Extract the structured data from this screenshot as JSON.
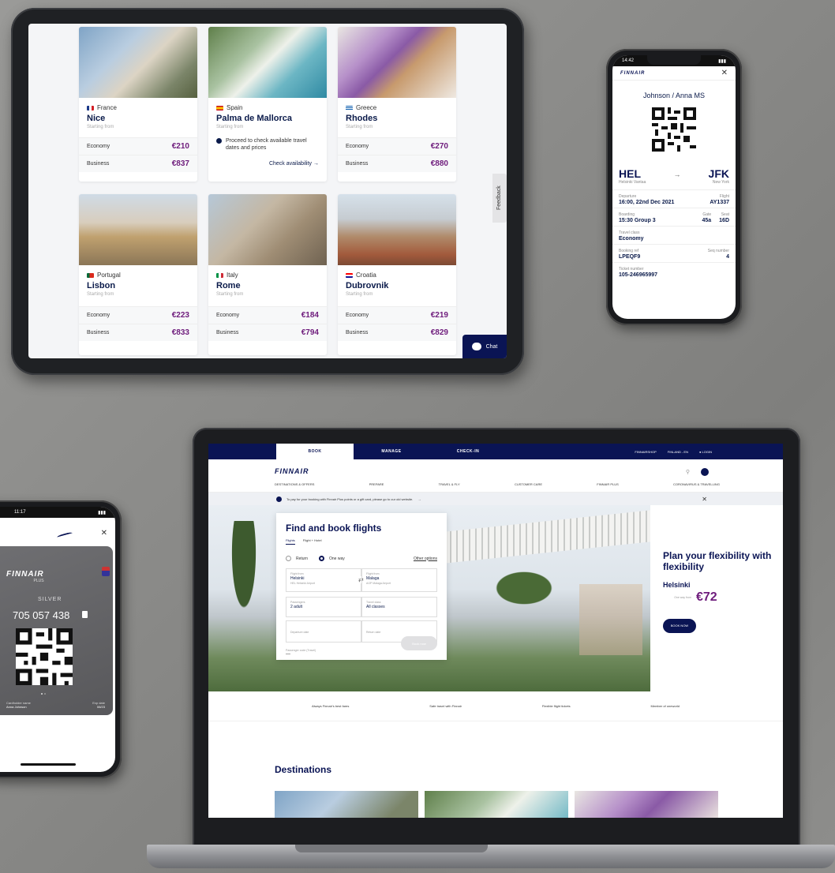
{
  "tablet": {
    "feedback_label": "Feedback",
    "chat_label": "Chat",
    "cards": [
      {
        "country": "France",
        "city": "Nice",
        "from": "Starting from",
        "economy_label": "Economy",
        "economy_price": "€210",
        "business_label": "Business",
        "business_price": "€837"
      },
      {
        "country": "Spain",
        "city": "Palma de Mallorca",
        "from": "Starting from",
        "info": "Proceed to check available travel dates and prices",
        "check_label": "Check availability →"
      },
      {
        "country": "Greece",
        "city": "Rhodes",
        "from": "Starting from",
        "economy_label": "Economy",
        "economy_price": "€270",
        "business_label": "Business",
        "business_price": "€880"
      },
      {
        "country": "Portugal",
        "city": "Lisbon",
        "from": "Starting from",
        "economy_label": "Economy",
        "economy_price": "€223",
        "business_label": "Business",
        "business_price": "€833"
      },
      {
        "country": "Italy",
        "city": "Rome",
        "from": "Starting from",
        "economy_label": "Economy",
        "economy_price": "€184",
        "business_label": "Business",
        "business_price": "€794"
      },
      {
        "country": "Croatia",
        "city": "Dubrovnik",
        "from": "Starting from",
        "economy_label": "Economy",
        "economy_price": "€219",
        "business_label": "Business",
        "business_price": "€829"
      }
    ]
  },
  "boarding_pass": {
    "time": "14:42",
    "logo": "FINNAIR",
    "close": "✕",
    "passenger": "Johnson / Anna MS",
    "from_code": "HEL",
    "from_city": "Helsinki Vantaa",
    "arrow": "→",
    "to_code": "JFK",
    "to_city": "New York",
    "departure_label": "Departure",
    "departure_value": "16:00, 22nd Dec 2021",
    "flight_label": "Flight",
    "flight_value": "AY1337",
    "boarding_label": "Boarding",
    "boarding_value": "15:30 Group 3",
    "gate_label": "Gate",
    "gate_value": "45a",
    "seat_label": "Seat",
    "seat_value": "16D",
    "class_label": "Travel class",
    "class_value": "Economy",
    "ref_label": "Booking ref",
    "ref_value": "LPEQF9",
    "seq_label": "Seq number",
    "seq_value": "4",
    "ticket_label": "Ticket number",
    "ticket_value": "105-246965997"
  },
  "plus_card": {
    "time": "11:17",
    "close": "✕",
    "logo": "FINNAIR",
    "sub": "PLUS",
    "tier": "SILVER",
    "number": "705 057 438",
    "holder_label": "Cardholder name",
    "holder_value": "Anna Johnson",
    "exp_label": "Exp date",
    "exp_value": "06/23"
  },
  "website": {
    "tabs": [
      "BOOK",
      "MANAGE",
      "CHECK-IN"
    ],
    "top_right": [
      "FINNAIRSHOP",
      "FINLAND - EN",
      "LOGIN"
    ],
    "logo": "FINNAIR",
    "nav": [
      "DESTINATIONS & OFFERS",
      "PREPARE",
      "TRAVEL & FLY",
      "CUSTOMER CARE",
      "FINNAIR PLUS",
      "CORONAVIRUS & TRAVELLING"
    ],
    "banner": "To pay for your booking with Finnair Plus points or a gift card, please go to our old website.",
    "banner_arrow": "→",
    "banner_close": "✕",
    "booking": {
      "title": "Find and book flights",
      "tab_flights": "Flights",
      "tab_hotel": "Flight + Hotel",
      "return_label": "Return",
      "oneway_label": "One way",
      "other_options": "Other options",
      "from_label": "Flight from",
      "from_value": "Helsinki",
      "from_sub": "HEL Helsinki Airport",
      "to_label": "Flight from",
      "to_value": "Malaga",
      "to_sub": "AGP Malaga Airport",
      "pax_label": "Passengers",
      "pax_value": "2 adult",
      "cabin_label": "Travel class",
      "cabin_value": "All classes",
      "dep_placeholder": "Departure date",
      "ret_placeholder": "Return date",
      "promo_label": "Passenger code (Travel)",
      "promo_value": "—",
      "search_label": "Book now"
    },
    "promo": {
      "title": "Plan your flexibility with flexibility",
      "city": "Helsinki",
      "from": "One way from",
      "price": "€72",
      "cta": "BOOK NOW"
    },
    "features": [
      "Always Finnair's best fares",
      "Safe travel with Finnair",
      "Flexible flight tickets",
      "Member of oneworld"
    ],
    "destinations_title": "Destinations"
  },
  "colors": {
    "navy": "#0a1454",
    "price_purple": "#6e1c7c"
  }
}
